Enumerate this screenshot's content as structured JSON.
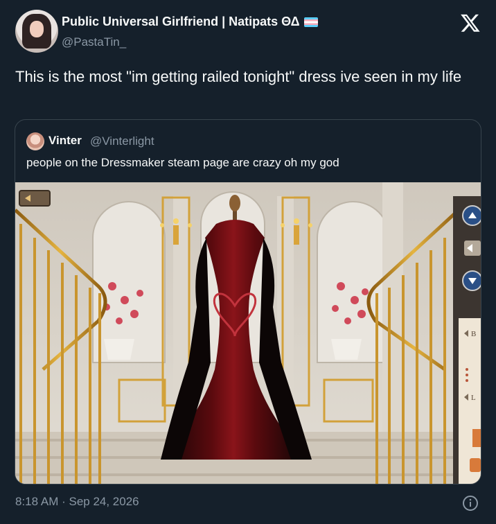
{
  "author": {
    "display_name": "Public Universal Girlfriend | Natipats ΘΔ",
    "handle": "@PastaTin_"
  },
  "tweet": {
    "text": "This is the most \"im getting railed tonight\" dress ive seen in my life",
    "timestamp": "8:18 AM · Sep 24, 2026"
  },
  "quoted": {
    "name": "Vinter",
    "handle": "@Vinterlight",
    "text": "people on the Dressmaker steam page are crazy oh my god"
  },
  "icons": {
    "platform": "x-logo-icon",
    "info": "info-icon",
    "flag": "trans-flag-icon"
  },
  "game_ui": {
    "side_letters": [
      "B",
      "L"
    ]
  },
  "colors": {
    "background": "#15202b",
    "text": "#f7f9f9",
    "muted": "#8b98a5",
    "border": "#38444d"
  }
}
